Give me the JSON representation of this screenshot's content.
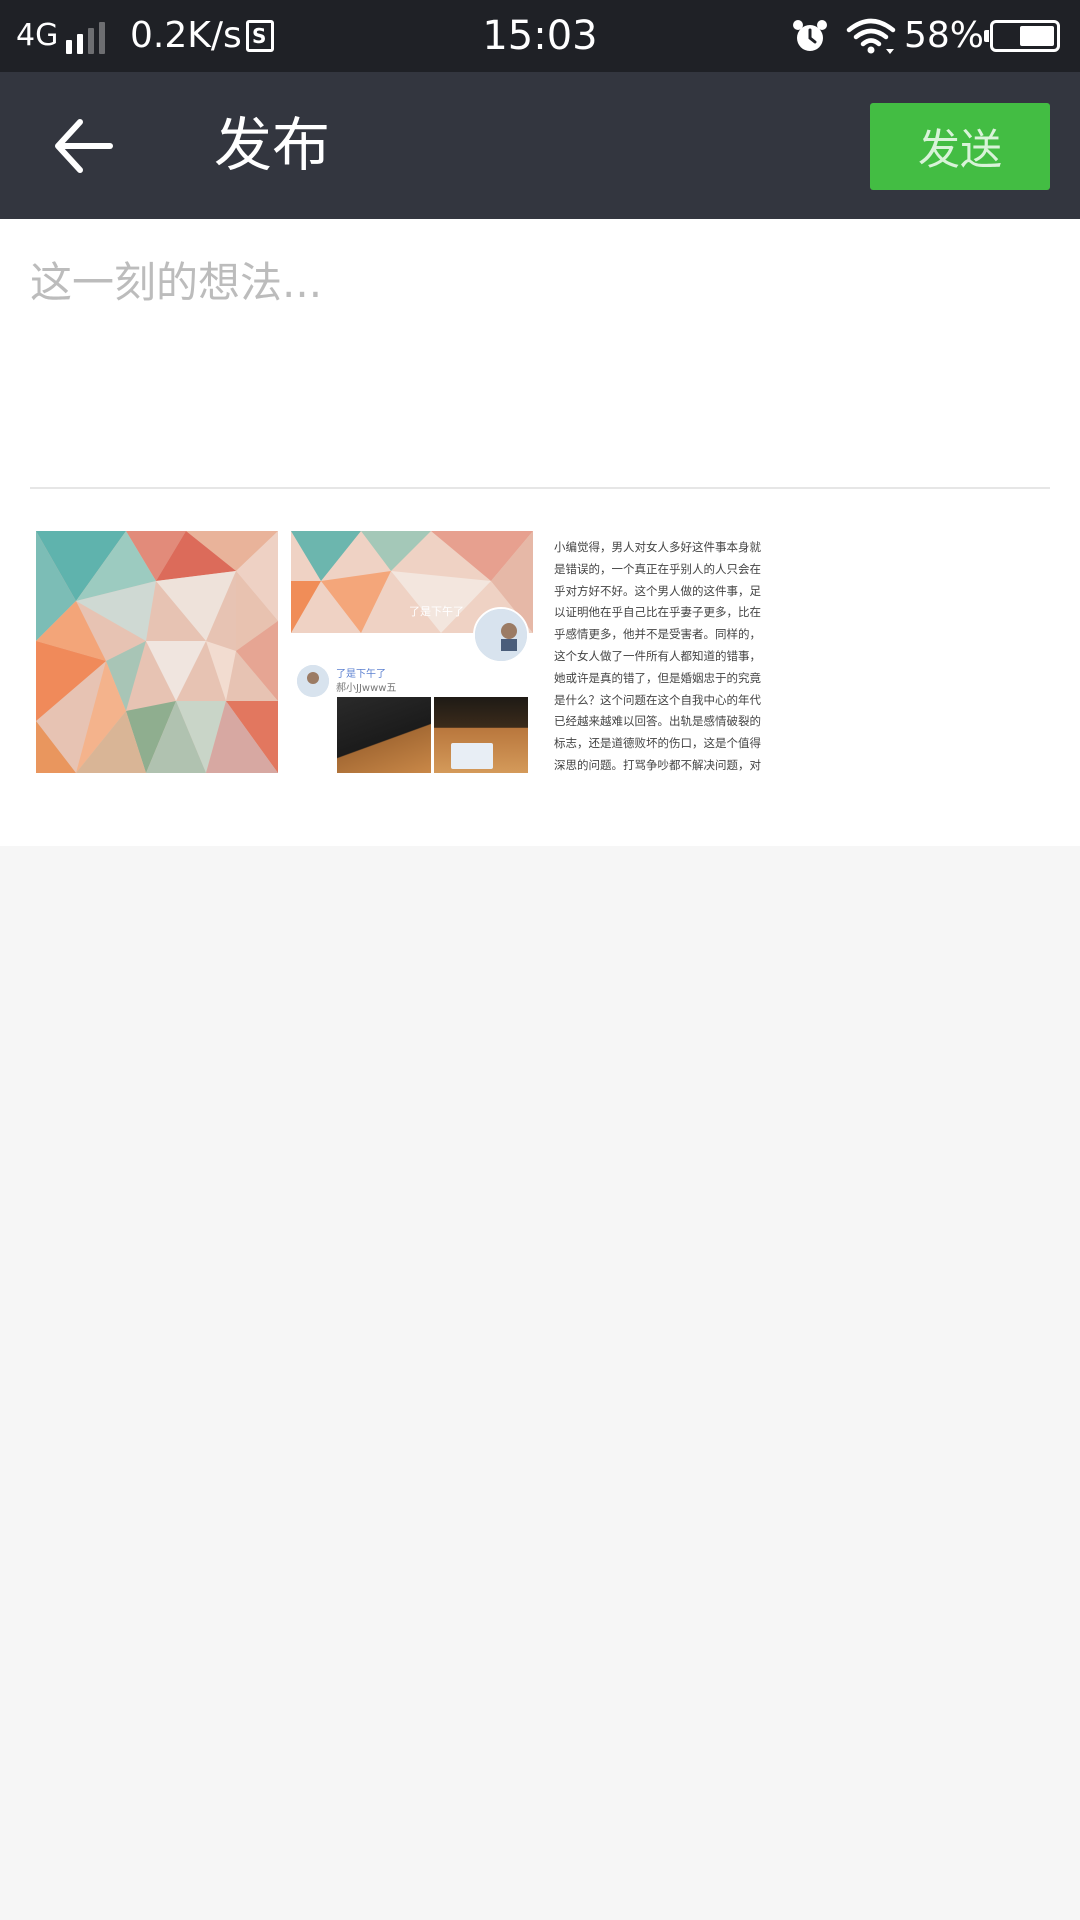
{
  "status_bar": {
    "network": "4G",
    "speed": "0.2K/s",
    "sim_label": "S",
    "time": "15:03",
    "battery_percent": "58%",
    "battery_level": 0.58,
    "signal_level": 2,
    "icons": [
      "signal-icon",
      "sim-icon",
      "alarm-icon",
      "wifi-icon",
      "battery-icon"
    ]
  },
  "header": {
    "back_icon": "back-arrow-icon",
    "title": "发布",
    "send_label": "发送",
    "send_color": "#43bd43",
    "bar_color": "#33363f"
  },
  "compose": {
    "placeholder": "这一刻的想法...",
    "value": ""
  },
  "attachments": [
    {
      "type": "image",
      "description_icon": "polygon-art-image"
    },
    {
      "type": "image",
      "banner_text": "了是下午了",
      "name": "了是下午了",
      "subtitle": "郝小JJwww五"
    },
    {
      "type": "image",
      "text_lines": [
        "小编觉得，男人对女人多好这件事本身就",
        "是错误的，一个真正在乎别人的人只会在",
        "乎对方好不好。这个男人做的这件事，足",
        "以证明他在乎自己比在乎妻子更多，比在",
        "乎感情更多，他并不是受害者。同样的，",
        "这个女人做了一件所有人都知道的错事，",
        "她或许是真的错了，但是婚姻忠于的究竟",
        "是什么？这个问题在这个自我中心的年代",
        "已经越来越难以回答。出轨是感情破裂的",
        "标志，还是道德败坏的伤口，这是个值得",
        "深思的问题。打骂争吵都不解决问题，对"
      ]
    }
  ]
}
